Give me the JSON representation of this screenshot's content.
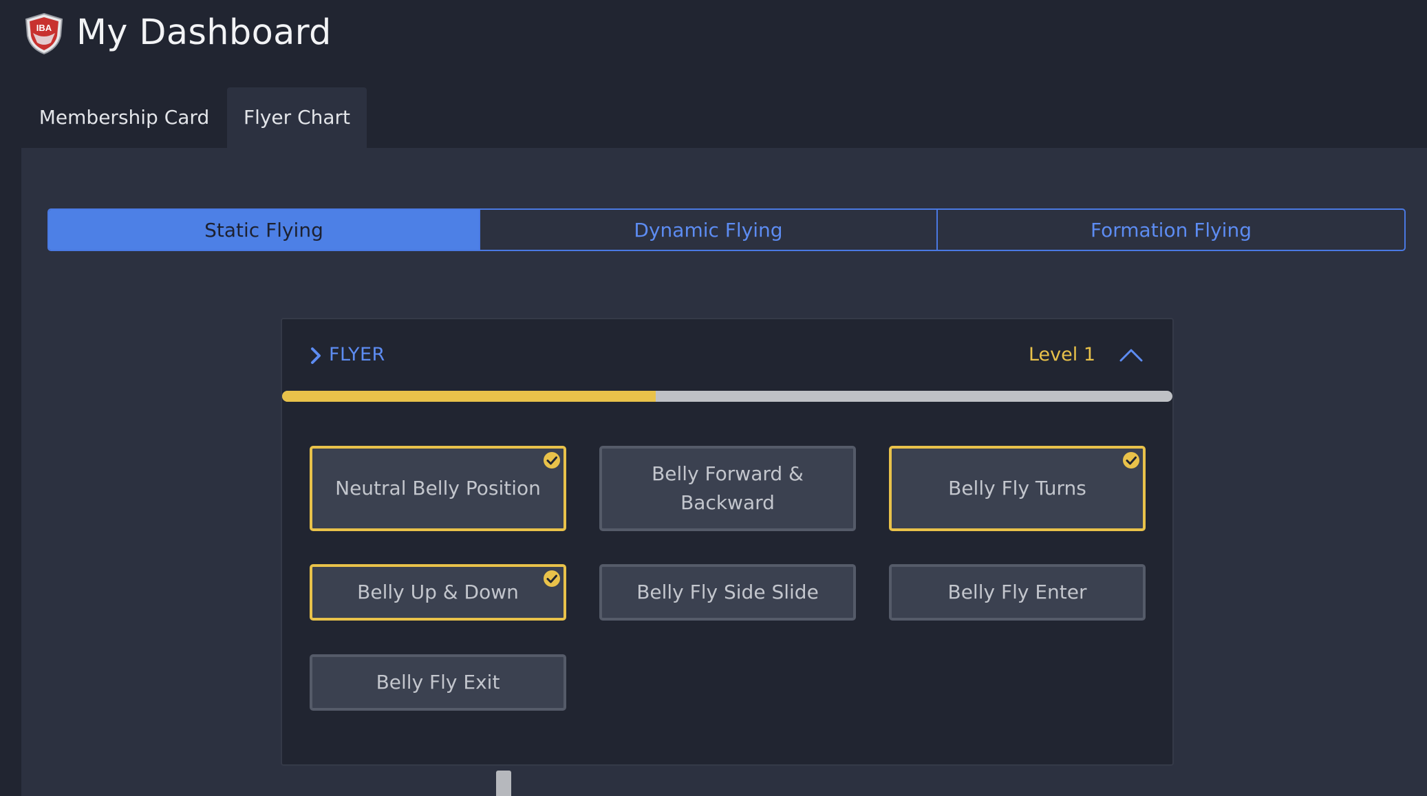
{
  "header": {
    "title": "My Dashboard",
    "logo_icon": "shield-logo-icon",
    "logo_text": "IBA"
  },
  "top_tabs": [
    {
      "label": "Membership Card",
      "active": false
    },
    {
      "label": "Flyer Chart",
      "active": true
    }
  ],
  "segments": [
    {
      "label": "Static Flying",
      "active": true
    },
    {
      "label": "Dynamic Flying",
      "active": false
    },
    {
      "label": "Formation Flying",
      "active": false
    }
  ],
  "card": {
    "title": "FLYER",
    "level": "Level 1",
    "progress": 0.42,
    "skills": [
      {
        "label": "Neutral Belly Position",
        "completed": true
      },
      {
        "label": "Belly Forward & Backward",
        "completed": false
      },
      {
        "label": "Belly Fly Turns",
        "completed": true
      },
      {
        "label": "Belly Up & Down",
        "completed": true
      },
      {
        "label": "Belly Fly Side Slide",
        "completed": false
      },
      {
        "label": "Belly Fly Enter",
        "completed": false
      },
      {
        "label": "Belly Fly Exit",
        "completed": false
      }
    ]
  },
  "colors": {
    "background": "#212531",
    "panel": "#2c3140",
    "accent_blue": "#4d80e6",
    "accent_yellow": "#e9c24a",
    "skill_bg": "#3b4150"
  }
}
